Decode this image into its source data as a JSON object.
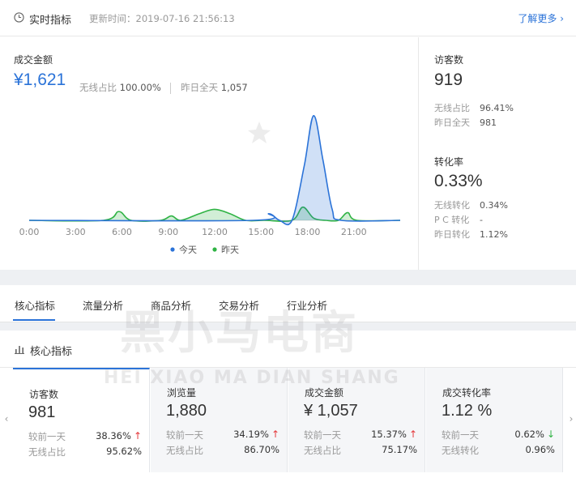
{
  "realtime": {
    "title": "实时指标",
    "update_label": "更新时间：2019-07-16 21:56:13",
    "learn_more": "了解更多 ›",
    "gmv": {
      "label": "成交金额",
      "value": "¥1,621",
      "wireless_label": "无线占比",
      "wireless_value": "100.00%",
      "yesterday_label": "昨日全天",
      "yesterday_value": "1,057"
    },
    "visitors": {
      "label": "访客数",
      "value": "919",
      "wireless_label": "无线占比",
      "wireless_value": "96.41%",
      "yesterday_label": "昨日全天",
      "yesterday_value": "981"
    },
    "conversion": {
      "label": "转化率",
      "value": "0.33%",
      "wireless_label": "无线转化",
      "wireless_value": "0.34%",
      "pc_label": "P C 转化",
      "pc_value": "-",
      "yesterday_label": "昨日转化",
      "yesterday_value": "1.12%"
    }
  },
  "chart_data": {
    "type": "area",
    "title": "",
    "xlabel": "",
    "ylabel": "",
    "x_ticks": [
      "0:00",
      "3:00",
      "6:00",
      "9:00",
      "12:00",
      "15:00",
      "18:00",
      "21:00"
    ],
    "xlim": [
      0,
      24
    ],
    "ylim": [
      0,
      1
    ],
    "grid": false,
    "legend_position": "bottom",
    "series": [
      {
        "name": "今天",
        "color": "#2b73d8",
        "points": [
          [
            0,
            0
          ],
          [
            14.5,
            0
          ],
          [
            15.5,
            0.06
          ],
          [
            16.2,
            0
          ],
          [
            17,
            0
          ],
          [
            17.8,
            0.5
          ],
          [
            18.4,
            0.95
          ],
          [
            19.0,
            0.55
          ],
          [
            19.6,
            0.1
          ],
          [
            20.2,
            0
          ],
          [
            24,
            0
          ]
        ]
      },
      {
        "name": "昨天",
        "color": "#2fb344",
        "points": [
          [
            0,
            0
          ],
          [
            4.8,
            0
          ],
          [
            5.8,
            0.08
          ],
          [
            6.6,
            0
          ],
          [
            8.5,
            0
          ],
          [
            9.2,
            0.04
          ],
          [
            9.8,
            0
          ],
          [
            11,
            0.06
          ],
          [
            12,
            0.1
          ],
          [
            13,
            0.06
          ],
          [
            14,
            0
          ],
          [
            15.2,
            0
          ],
          [
            17,
            0
          ],
          [
            17.7,
            0.12
          ],
          [
            18.4,
            0.02
          ],
          [
            19.2,
            0
          ],
          [
            20,
            0
          ],
          [
            20.6,
            0.07
          ],
          [
            21.2,
            0
          ],
          [
            24,
            0
          ]
        ]
      }
    ]
  },
  "tabs": [
    {
      "label": "核心指标"
    },
    {
      "label": "流量分析"
    },
    {
      "label": "商品分析"
    },
    {
      "label": "交易分析"
    },
    {
      "label": "行业分析"
    }
  ],
  "core": {
    "title": "核心指标",
    "nav_left": "‹",
    "nav_right": "›",
    "cards": [
      {
        "label": "访客数",
        "value": "981",
        "cmp_label": "较前一天",
        "cmp_value": "38.36%",
        "trend": "↑",
        "wl_label": "无线占比",
        "wl_value": "95.62%"
      },
      {
        "label": "浏览量",
        "value": "1,880",
        "cmp_label": "较前一天",
        "cmp_value": "34.19%",
        "trend": "↑",
        "wl_label": "无线占比",
        "wl_value": "86.70%"
      },
      {
        "label": "成交金额",
        "value": "¥ 1,057",
        "cmp_label": "较前一天",
        "cmp_value": "15.37%",
        "trend": "↑",
        "wl_label": "无线占比",
        "wl_value": "75.17%"
      },
      {
        "label": "成交转化率",
        "value": "1.12 %",
        "cmp_label": "较前一天",
        "cmp_value": "0.62%",
        "trend": "↓",
        "wl_label": "无线转化",
        "wl_value": "0.96%"
      }
    ]
  },
  "watermark": {
    "cn": "黑小马电商",
    "en": "HEI XIAO MA DIAN SHANG"
  },
  "colors": {
    "accent": "#2b73d8",
    "up": "#e4393c",
    "down": "#2fb344"
  }
}
